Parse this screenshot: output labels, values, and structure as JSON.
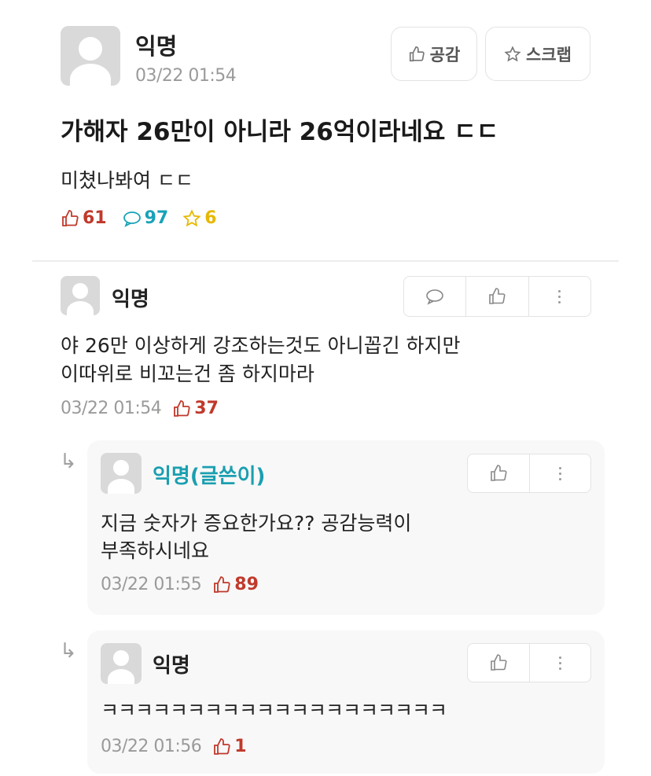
{
  "post": {
    "author": "익명",
    "time": "03/22 01:54",
    "empathy_label": "공감",
    "scrap_label": "스크랩",
    "title": "가해자 26만이 아니라 26억이라네요 ㄷㄷ",
    "body": "미쳤나봐여 ㄷㄷ",
    "stats": {
      "likes": "61",
      "comments": "97",
      "scraps": "6"
    }
  },
  "comment": {
    "author": "익명",
    "text_line1": "야 26만 이상하게 강조하는것도 아니꼽긴 하지만",
    "text_line2": "이따위로 비꼬는건 좀 하지마라",
    "time": "03/22 01:54",
    "likes": "37"
  },
  "replies": [
    {
      "author": "익명(글쓴이)",
      "text_line1": "지금 숫자가 증요한가요?? 공감능력이",
      "text_line2": "부족하시네요",
      "time": "03/22 01:55",
      "likes": "89"
    },
    {
      "author": "익명",
      "text_line1": "ㅋㅋㅋㅋㅋㅋㅋㅋㅋㅋㅋㅋㅋㅋㅋㅋㅋㅋㅋㅋ",
      "time": "03/22 01:56",
      "likes": "1"
    }
  ],
  "colors": {
    "like_red": "#c0392b",
    "comment_teal": "#17a2b8",
    "scrap_yellow": "#e6b800",
    "op_author_teal": "#1a9fb0"
  }
}
